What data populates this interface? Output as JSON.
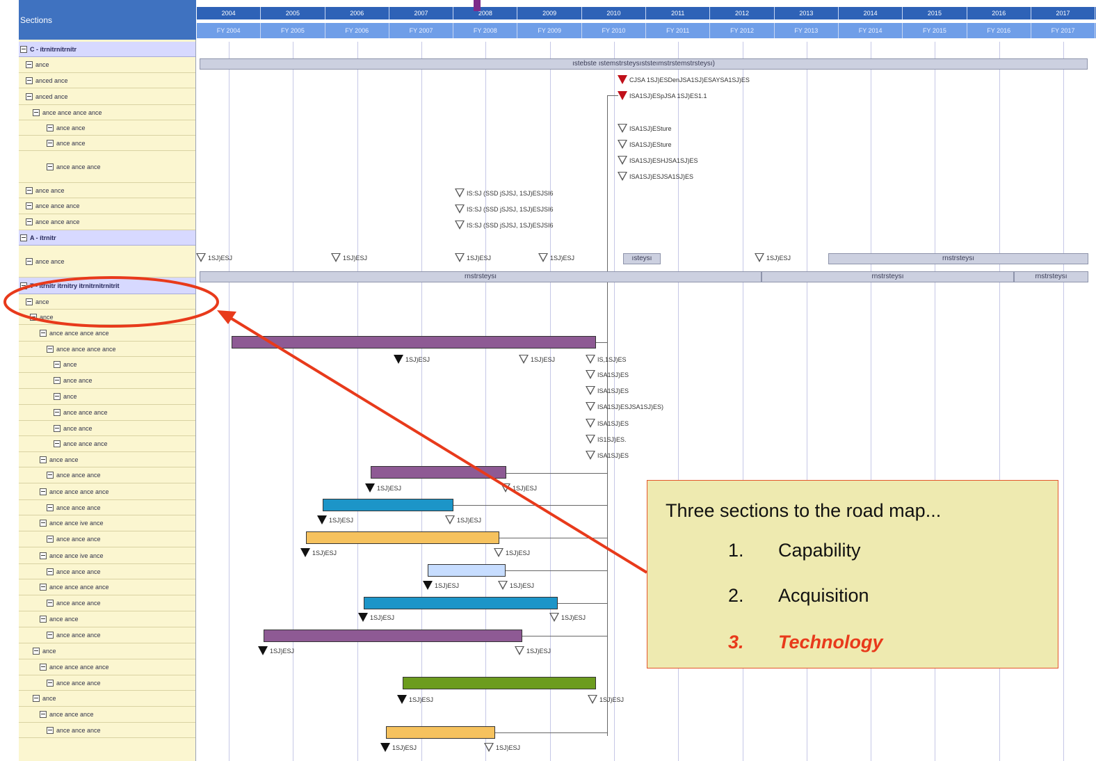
{
  "header": {
    "sections_label": "Sections",
    "years": [
      "2004",
      "2005",
      "2006",
      "2007",
      "2008",
      "2009",
      "2010",
      "2011",
      "2012",
      "2013",
      "2014",
      "2015",
      "2016",
      "2017"
    ],
    "fiscal_years": [
      "FY 2004",
      "FY 2005",
      "FY 2006",
      "FY 2007",
      "FY 2008",
      "FY 2009",
      "FY 2010",
      "FY 2011",
      "FY 2012",
      "FY 2013",
      "FY 2014",
      "FY 2015",
      "FY 2016",
      "FY 2017"
    ]
  },
  "sections": [
    {
      "label": "C - ítrnitrnítrnítr",
      "kind": "section"
    },
    {
      "label": "ance",
      "kind": "row"
    },
    {
      "label": "anced ance",
      "kind": "row"
    },
    {
      "label": "anced ance",
      "kind": "row"
    },
    {
      "label": "ance ance ance ance",
      "kind": "row"
    },
    {
      "label": "ance ance",
      "kind": "row"
    },
    {
      "label": "ance ance",
      "kind": "row"
    },
    {
      "label": "ance ance ance",
      "kind": "row"
    },
    {
      "label": "ance ance",
      "kind": "row"
    },
    {
      "label": "ance ance ance",
      "kind": "row"
    },
    {
      "label": "ance ance ance",
      "kind": "row"
    },
    {
      "label": "A - ítrnitr",
      "kind": "section"
    },
    {
      "label": "ance ance",
      "kind": "row"
    },
    {
      "label": "T - itrnitr itrnitry itrnitrnitrnitrit",
      "kind": "section"
    },
    {
      "label": "ance",
      "kind": "row"
    },
    {
      "label": "ance",
      "kind": "row"
    },
    {
      "label": "ance ance ance ance",
      "kind": "row"
    },
    {
      "label": "ance ance ance ance",
      "kind": "row"
    },
    {
      "label": "ance",
      "kind": "row"
    },
    {
      "label": "ance ance",
      "kind": "row"
    },
    {
      "label": "ance",
      "kind": "row"
    },
    {
      "label": "ance ance ance",
      "kind": "row"
    },
    {
      "label": "ance ance",
      "kind": "row"
    },
    {
      "label": "ance ance ance",
      "kind": "row"
    },
    {
      "label": "ance ance",
      "kind": "row"
    },
    {
      "label": "ance ance ance",
      "kind": "row"
    },
    {
      "label": "ance ance ance ance",
      "kind": "row"
    },
    {
      "label": "ance ance ance",
      "kind": "row"
    },
    {
      "label": "ance ance ive ance",
      "kind": "row"
    },
    {
      "label": "ance ance ance",
      "kind": "row"
    },
    {
      "label": "ance ance ive ance",
      "kind": "row"
    },
    {
      "label": "ance ance ance",
      "kind": "row"
    },
    {
      "label": "ance ance ance ance",
      "kind": "row"
    },
    {
      "label": "ance ance ance",
      "kind": "row"
    },
    {
      "label": "ance ance",
      "kind": "row"
    },
    {
      "label": "ance ance ance",
      "kind": "row"
    },
    {
      "label": "ance",
      "kind": "row"
    },
    {
      "label": "ance ance ance ance",
      "kind": "row"
    },
    {
      "label": "ance ance ance",
      "kind": "row"
    },
    {
      "label": "ance",
      "kind": "row"
    },
    {
      "label": "ance ance ance",
      "kind": "row"
    },
    {
      "label": "ance ance ance",
      "kind": "row"
    }
  ],
  "bands": {
    "capability": "ıstebste ıstemstrsteysıststeımstrstemstrsteysı)",
    "acq_a": "ısteysı",
    "acq_b": "rnstrsteysı",
    "acq_c": "rnstrsteysı",
    "acq_d": "rnstrsteysı",
    "acq_e": "rnstrsteysı"
  },
  "milestones": {
    "red1": "CJSA 1SJ)ESDenJSA1SJ)ESAYSA1SJ)ES",
    "red2": "ISA1SJ)ESpJSA 1SJ)ES1.1",
    "cap1": "ISA1SJ)ESture",
    "cap2": "ISA1SJ)ESture",
    "cap3": "ISA1SJ)ESHJSA1SJ)ES",
    "cap4": "ISA1SJ)ESJSA1SJ)ES",
    "mid1": "IS:SJ (SSD jSJSJ, 1SJ)ESJSI6",
    "mid2": "IS:SJ (SSD jSJSJ, 1SJ)ESJSI6",
    "mid3": "IS:SJ (SSD jSJSJ, 1SJ)ESJSI6",
    "acq_m": "1SJ)ESJ",
    "t1": "1SJ)ESJ",
    "t2": "1SJ)ESJ",
    "t3": "IS,1SJ)ES",
    "t4": "ISA1SJ)ES",
    "t5": "ISA1SJ)ES",
    "t6": "ISA1SJ)ESJSA1SJ)ES)",
    "t7": "ISA1SJ)ES",
    "t8": "IS1SJ)ES.",
    "t9": "ISA1SJ)ES"
  },
  "callout": {
    "intro": "Three sections to the road map...",
    "items": [
      {
        "num": "1.",
        "text": "Capability"
      },
      {
        "num": "2.",
        "text": "Acquisition"
      },
      {
        "num": "3.",
        "text": "Technology"
      }
    ]
  },
  "colors": {
    "purple_bar": "#8e5a94",
    "blue_bar": "#1c95c8",
    "orange_bar": "#f6c25e",
    "lightblue_bar": "#c7ddff",
    "green_bar": "#6c9c1e",
    "highlight": "#e83a1b",
    "callout_bg": "#eeeab0"
  }
}
